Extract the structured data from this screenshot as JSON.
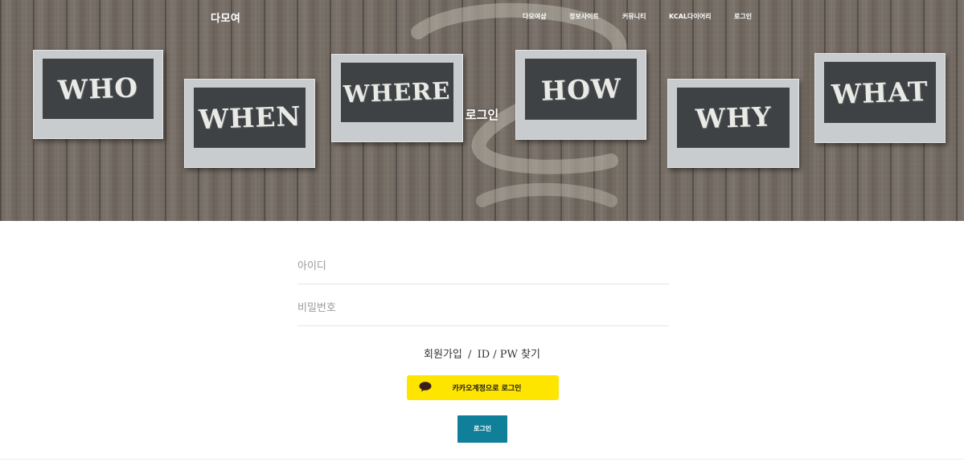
{
  "nav": {
    "brand": "다모여",
    "links": [
      "다모여샵",
      "정보사이트",
      "커뮤니티",
      "KCAL다이어리",
      "로그인"
    ]
  },
  "hero": {
    "title": "로그인",
    "boards": [
      "WHO",
      "WHEN",
      "WHERE",
      "HOW",
      "WHY",
      "WHAT"
    ]
  },
  "form": {
    "id_placeholder": "아이디",
    "pw_placeholder": "비밀번호",
    "signup_link": "회원가입",
    "separator": "/",
    "find_link": "ID / PW 찾기",
    "kakao_label": "카카오계정으로 로그인",
    "login_button": "로그인"
  },
  "colors": {
    "kakao": "#fee500",
    "login_button": "#0f7f9a"
  },
  "icons": {
    "kakao": "speech-bubble-icon"
  }
}
